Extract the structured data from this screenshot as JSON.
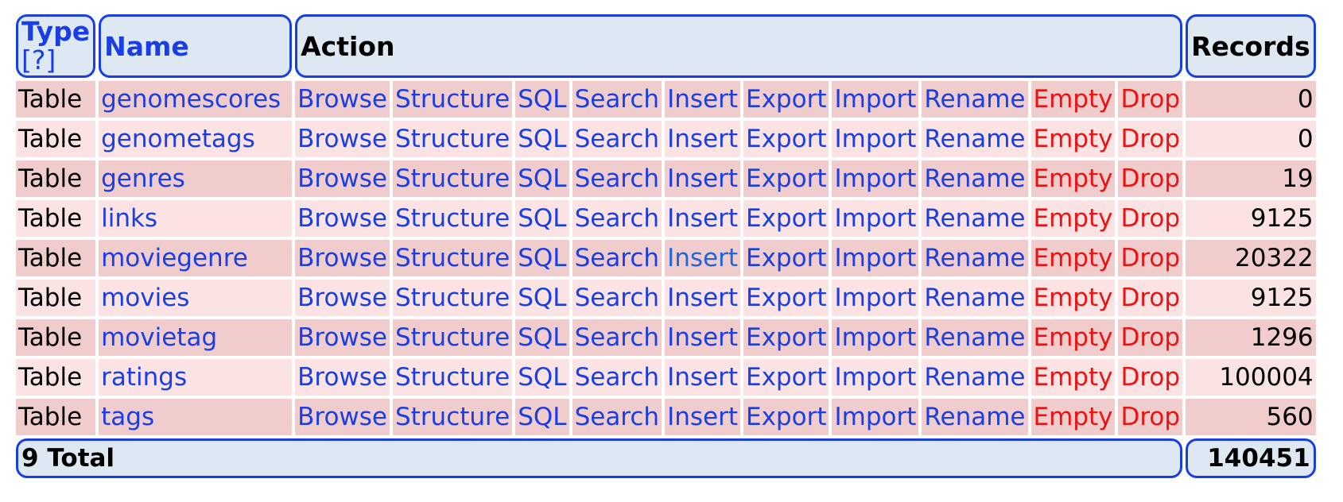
{
  "header": {
    "type": "Type",
    "type_help": "[?]",
    "name": "Name",
    "action": "Action",
    "records": "Records"
  },
  "actions": {
    "browse": "Browse",
    "structure": "Structure",
    "sql": "SQL",
    "search": "Search",
    "insert": "Insert",
    "export": "Export",
    "import": "Import",
    "rename": "Rename",
    "empty": "Empty",
    "drop": "Drop"
  },
  "rows": [
    {
      "type": "Table",
      "name": "genomescores",
      "records": "0"
    },
    {
      "type": "Table",
      "name": "genometags",
      "records": "0"
    },
    {
      "type": "Table",
      "name": "genres",
      "records": "19"
    },
    {
      "type": "Table",
      "name": "links",
      "records": "9125"
    },
    {
      "type": "Table",
      "name": "moviegenre",
      "records": "20322"
    },
    {
      "type": "Table",
      "name": "movies",
      "records": "9125"
    },
    {
      "type": "Table",
      "name": "movietag",
      "records": "1296"
    },
    {
      "type": "Table",
      "name": "ratings",
      "records": "100004"
    },
    {
      "type": "Table",
      "name": "tags",
      "records": "560"
    }
  ],
  "footer": {
    "total_label": "9 Total",
    "total_records": "140451"
  },
  "colors": {
    "link": "#1a3ee6",
    "danger": "#ee1111",
    "header_bg": "#dde8f3",
    "row_odd": "#f0cccc",
    "row_even": "#fbe3e3"
  }
}
